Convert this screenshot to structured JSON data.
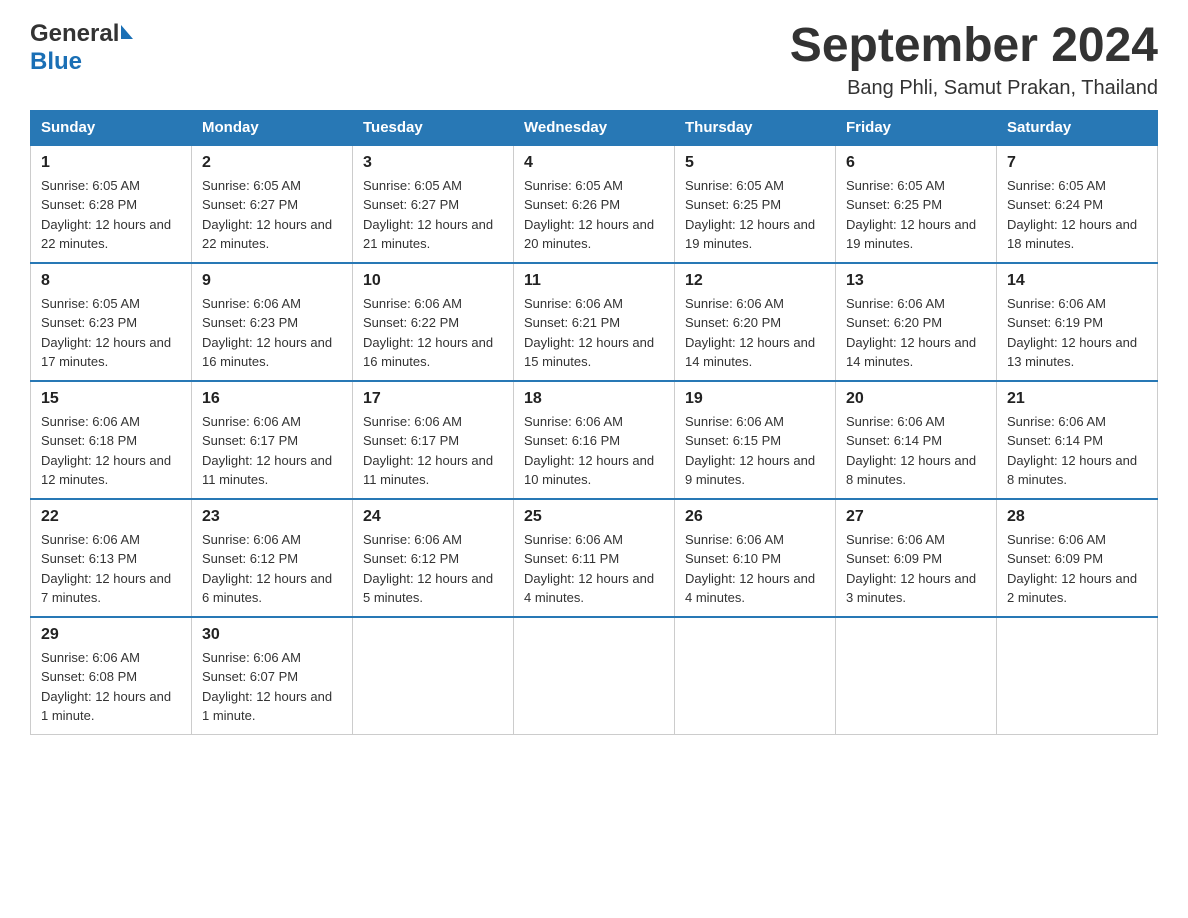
{
  "header": {
    "logo_general": "General",
    "logo_blue": "Blue",
    "month_title": "September 2024",
    "location": "Bang Phli, Samut Prakan, Thailand"
  },
  "days_of_week": [
    "Sunday",
    "Monday",
    "Tuesday",
    "Wednesday",
    "Thursday",
    "Friday",
    "Saturday"
  ],
  "weeks": [
    [
      {
        "day": "1",
        "sunrise": "Sunrise: 6:05 AM",
        "sunset": "Sunset: 6:28 PM",
        "daylight": "Daylight: 12 hours and 22 minutes."
      },
      {
        "day": "2",
        "sunrise": "Sunrise: 6:05 AM",
        "sunset": "Sunset: 6:27 PM",
        "daylight": "Daylight: 12 hours and 22 minutes."
      },
      {
        "day": "3",
        "sunrise": "Sunrise: 6:05 AM",
        "sunset": "Sunset: 6:27 PM",
        "daylight": "Daylight: 12 hours and 21 minutes."
      },
      {
        "day": "4",
        "sunrise": "Sunrise: 6:05 AM",
        "sunset": "Sunset: 6:26 PM",
        "daylight": "Daylight: 12 hours and 20 minutes."
      },
      {
        "day": "5",
        "sunrise": "Sunrise: 6:05 AM",
        "sunset": "Sunset: 6:25 PM",
        "daylight": "Daylight: 12 hours and 19 minutes."
      },
      {
        "day": "6",
        "sunrise": "Sunrise: 6:05 AM",
        "sunset": "Sunset: 6:25 PM",
        "daylight": "Daylight: 12 hours and 19 minutes."
      },
      {
        "day": "7",
        "sunrise": "Sunrise: 6:05 AM",
        "sunset": "Sunset: 6:24 PM",
        "daylight": "Daylight: 12 hours and 18 minutes."
      }
    ],
    [
      {
        "day": "8",
        "sunrise": "Sunrise: 6:05 AM",
        "sunset": "Sunset: 6:23 PM",
        "daylight": "Daylight: 12 hours and 17 minutes."
      },
      {
        "day": "9",
        "sunrise": "Sunrise: 6:06 AM",
        "sunset": "Sunset: 6:23 PM",
        "daylight": "Daylight: 12 hours and 16 minutes."
      },
      {
        "day": "10",
        "sunrise": "Sunrise: 6:06 AM",
        "sunset": "Sunset: 6:22 PM",
        "daylight": "Daylight: 12 hours and 16 minutes."
      },
      {
        "day": "11",
        "sunrise": "Sunrise: 6:06 AM",
        "sunset": "Sunset: 6:21 PM",
        "daylight": "Daylight: 12 hours and 15 minutes."
      },
      {
        "day": "12",
        "sunrise": "Sunrise: 6:06 AM",
        "sunset": "Sunset: 6:20 PM",
        "daylight": "Daylight: 12 hours and 14 minutes."
      },
      {
        "day": "13",
        "sunrise": "Sunrise: 6:06 AM",
        "sunset": "Sunset: 6:20 PM",
        "daylight": "Daylight: 12 hours and 14 minutes."
      },
      {
        "day": "14",
        "sunrise": "Sunrise: 6:06 AM",
        "sunset": "Sunset: 6:19 PM",
        "daylight": "Daylight: 12 hours and 13 minutes."
      }
    ],
    [
      {
        "day": "15",
        "sunrise": "Sunrise: 6:06 AM",
        "sunset": "Sunset: 6:18 PM",
        "daylight": "Daylight: 12 hours and 12 minutes."
      },
      {
        "day": "16",
        "sunrise": "Sunrise: 6:06 AM",
        "sunset": "Sunset: 6:17 PM",
        "daylight": "Daylight: 12 hours and 11 minutes."
      },
      {
        "day": "17",
        "sunrise": "Sunrise: 6:06 AM",
        "sunset": "Sunset: 6:17 PM",
        "daylight": "Daylight: 12 hours and 11 minutes."
      },
      {
        "day": "18",
        "sunrise": "Sunrise: 6:06 AM",
        "sunset": "Sunset: 6:16 PM",
        "daylight": "Daylight: 12 hours and 10 minutes."
      },
      {
        "day": "19",
        "sunrise": "Sunrise: 6:06 AM",
        "sunset": "Sunset: 6:15 PM",
        "daylight": "Daylight: 12 hours and 9 minutes."
      },
      {
        "day": "20",
        "sunrise": "Sunrise: 6:06 AM",
        "sunset": "Sunset: 6:14 PM",
        "daylight": "Daylight: 12 hours and 8 minutes."
      },
      {
        "day": "21",
        "sunrise": "Sunrise: 6:06 AM",
        "sunset": "Sunset: 6:14 PM",
        "daylight": "Daylight: 12 hours and 8 minutes."
      }
    ],
    [
      {
        "day": "22",
        "sunrise": "Sunrise: 6:06 AM",
        "sunset": "Sunset: 6:13 PM",
        "daylight": "Daylight: 12 hours and 7 minutes."
      },
      {
        "day": "23",
        "sunrise": "Sunrise: 6:06 AM",
        "sunset": "Sunset: 6:12 PM",
        "daylight": "Daylight: 12 hours and 6 minutes."
      },
      {
        "day": "24",
        "sunrise": "Sunrise: 6:06 AM",
        "sunset": "Sunset: 6:12 PM",
        "daylight": "Daylight: 12 hours and 5 minutes."
      },
      {
        "day": "25",
        "sunrise": "Sunrise: 6:06 AM",
        "sunset": "Sunset: 6:11 PM",
        "daylight": "Daylight: 12 hours and 4 minutes."
      },
      {
        "day": "26",
        "sunrise": "Sunrise: 6:06 AM",
        "sunset": "Sunset: 6:10 PM",
        "daylight": "Daylight: 12 hours and 4 minutes."
      },
      {
        "day": "27",
        "sunrise": "Sunrise: 6:06 AM",
        "sunset": "Sunset: 6:09 PM",
        "daylight": "Daylight: 12 hours and 3 minutes."
      },
      {
        "day": "28",
        "sunrise": "Sunrise: 6:06 AM",
        "sunset": "Sunset: 6:09 PM",
        "daylight": "Daylight: 12 hours and 2 minutes."
      }
    ],
    [
      {
        "day": "29",
        "sunrise": "Sunrise: 6:06 AM",
        "sunset": "Sunset: 6:08 PM",
        "daylight": "Daylight: 12 hours and 1 minute."
      },
      {
        "day": "30",
        "sunrise": "Sunrise: 6:06 AM",
        "sunset": "Sunset: 6:07 PM",
        "daylight": "Daylight: 12 hours and 1 minute."
      },
      null,
      null,
      null,
      null,
      null
    ]
  ]
}
